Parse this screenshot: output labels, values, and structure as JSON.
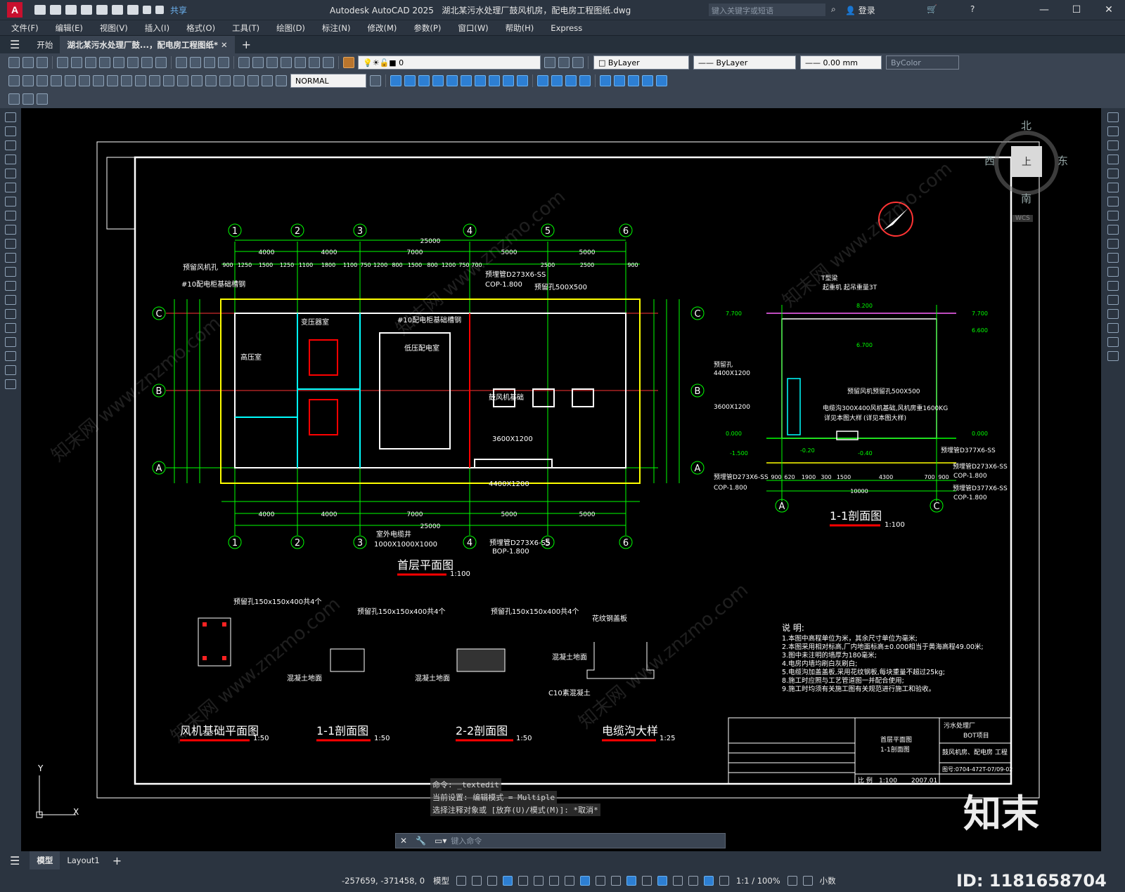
{
  "title": {
    "app_name": "Autodesk AutoCAD 2025",
    "file_name": "湖北某污水处理厂鼓风机房，配电房工程图纸.dwg",
    "share_label": "共享",
    "search_placeholder": "键入关键字或短语",
    "login_label": "登录"
  },
  "menu": [
    "文件(F)",
    "编辑(E)",
    "视图(V)",
    "插入(I)",
    "格式(O)",
    "工具(T)",
    "绘图(D)",
    "标注(N)",
    "修改(M)",
    "参数(P)",
    "窗口(W)",
    "帮助(H)",
    "Express"
  ],
  "tabs": {
    "start": "开始",
    "document": "湖北某污水处理厂鼓...，配电房工程图纸*"
  },
  "toolbar": {
    "layer": "0",
    "color": "ByLayer",
    "linetype": "ByLayer",
    "lineweight": "0.00 mm",
    "plotstyle": "ByColor",
    "dimstyle": "NORMAL"
  },
  "viewcube": {
    "north": "北",
    "south": "南",
    "east": "东",
    "west": "西",
    "top": "上",
    "wcs": "WCS"
  },
  "drawing": {
    "axes_top": [
      "1",
      "2",
      "3",
      "4",
      "5",
      "6"
    ],
    "axes_side": [
      "C",
      "B",
      "A"
    ],
    "total_dim": "25000",
    "dims_row1": [
      "4000",
      "4000",
      "7000",
      "5000",
      "5000"
    ],
    "dims_row2": [
      "900",
      "1250",
      "1500",
      "1250",
      "1100",
      "1800",
      "1100",
      "750",
      "1200",
      "800",
      "1500",
      "800",
      "1200",
      "750",
      "700",
      "2500",
      "2500",
      "900"
    ],
    "notes_plan": [
      "预留风机孔",
      "#10配电柜基础槽钢",
      "预埋管D273X6-SS",
      "COP-1.800",
      "预留孔500X500",
      "变压器室",
      "低压配电室",
      "高压室",
      "#10配电柜基础槽钢",
      "鼓风机基础",
      "3600X1200",
      "4400X1200",
      "室外电缆井",
      "1000X1000X1000",
      "预埋管D273X6-SS",
      "BOP-1.800"
    ],
    "plan_title": "首层平面图",
    "plan_scale": "1:100",
    "section_title": "1-1剖面图",
    "section_scale": "1:100",
    "section_notes": [
      "T型梁",
      "起重机 起吊重量3T",
      "预留孔",
      "4400X1200",
      "3600X1200",
      "预留风机预留孔500X500",
      "电缆沟300X400风机基础,风机房重1600KG",
      "详见本图大样",
      "(详见本图大样)",
      "预埋管D377X6-SS",
      "预埋管D273X6-SS",
      "COP-1.800",
      "预埋管D377X6-SS",
      "COP-1.800",
      "预埋管D273X6-SS",
      "COP-1.800"
    ],
    "section_levels": [
      "7.700",
      "8.200",
      "7.700",
      "6.600",
      "6.700",
      "0.000",
      "0.000",
      "-1.500",
      "-0.20",
      "-0.40"
    ],
    "section_dims": [
      "900",
      "620",
      "1900",
      "300",
      "1500",
      "4300",
      "700",
      "900",
      "10000"
    ],
    "detail_titles": [
      {
        "title": "风机基础平面图",
        "scale": "1:50"
      },
      {
        "title": "1-1剖面图",
        "scale": "1:50"
      },
      {
        "title": "2-2剖面图",
        "scale": "1:50"
      },
      {
        "title": "电缆沟大样",
        "scale": "1:25"
      }
    ],
    "detail_notes": [
      "预留孔150x150x400共4个",
      "预留孔150x150x400共4个",
      "预留孔150x150x400共4个",
      "花纹钢盖板",
      "混凝土地面",
      "混凝土地面",
      "混凝土地面",
      "C10素混凝土"
    ],
    "notes_heading": "说 明:",
    "notes": [
      "1.本图中高程单位为米，其余尺寸单位为毫米;",
      "2.本图采用相对标高,厂内地面标高±0.000相当于黄海高程49.00米;",
      "3.图中未注明的墙厚为180毫米;",
      "4.电房内墙均刷白灰刷白;",
      "5.电缆沟加盖盖板,采用花纹钢板,每块重量不超过25kg;",
      "8.施工时应照与工艺管道图一并配合使用;",
      "9.施工时均须有关施工图有关规范进行施工和验收。"
    ],
    "titleblock": {
      "drawing_name_1": "首层平面图",
      "drawing_name_2": "1-1剖面图",
      "project": "污水处理厂",
      "project_2": "BOT项目",
      "building": "鼓风机房、配电房 工程",
      "drawing_no": "图号:0704-472T-07/09-02",
      "scale_label": "比 例",
      "scale": "1:100",
      "date": "2007.01"
    }
  },
  "cmd": {
    "history": [
      "命令: _textedit",
      "当前设置: 编辑模式 = Multiple",
      "选择注释对象或 [放弃(U)/模式(M)]: *取消*"
    ],
    "placeholder": "键入命令"
  },
  "layout_tabs": [
    "模型",
    "Layout1"
  ],
  "status": {
    "coords": "-257659, -371458, 0",
    "model": "模型",
    "scale": "1:1 / 100%",
    "units": "小数"
  },
  "watermark": {
    "brand": "知末",
    "id": "ID: 1181658704",
    "diag": "知末网 www.znzmo.com"
  }
}
